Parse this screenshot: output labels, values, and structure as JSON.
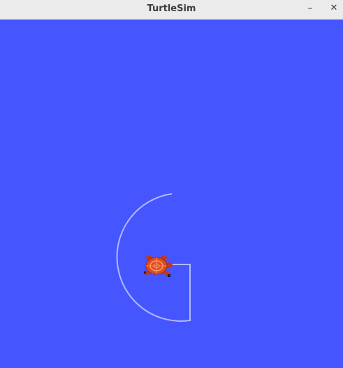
{
  "window": {
    "title": "TurtleSim",
    "minimize_glyph": "–",
    "close_glyph": "✕"
  },
  "canvas": {
    "background_color": "#4556ff",
    "pen_color": "#b3b8ff"
  },
  "turtle": {
    "icon": "turtle-icon",
    "shell_color": "#e24a1c",
    "limb_color": "#c5361a"
  }
}
